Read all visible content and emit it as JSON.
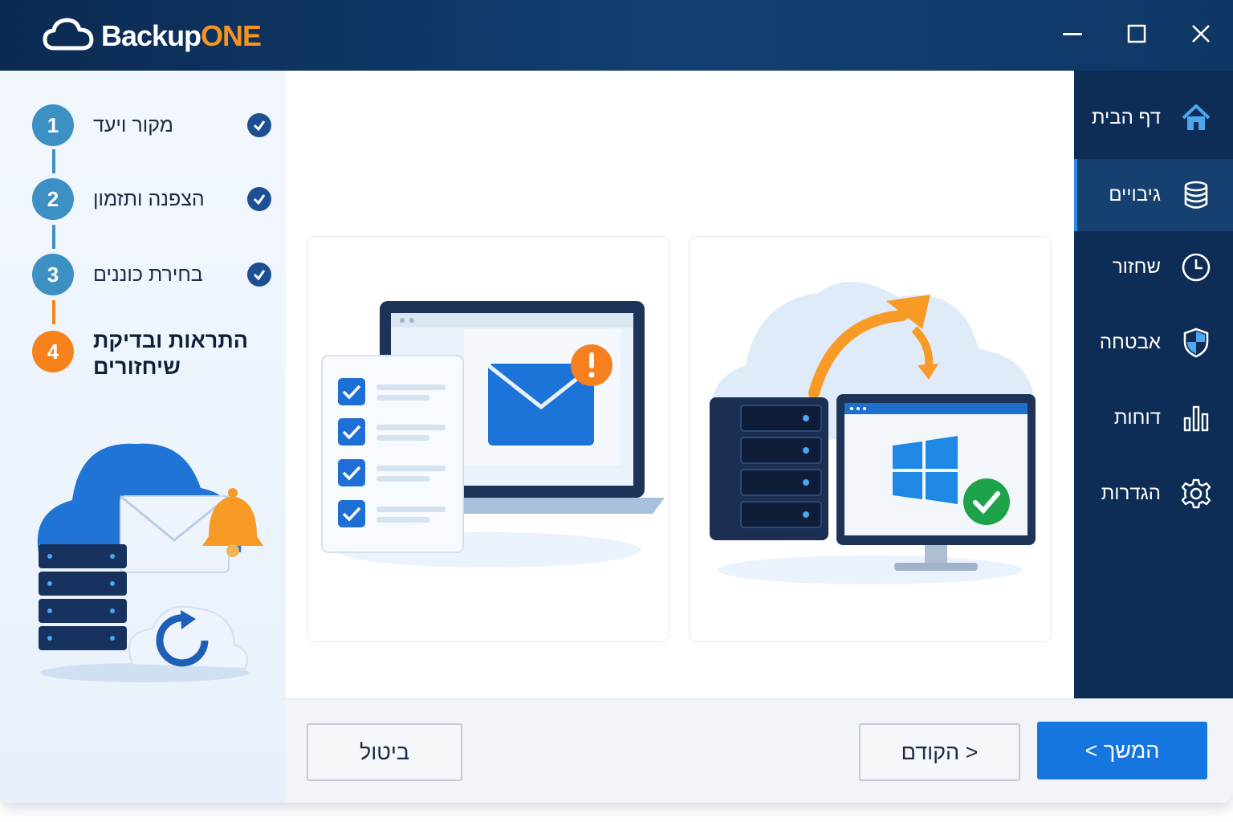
{
  "app": {
    "logo_prefix": "Backup",
    "logo_suffix": "ONE",
    "brand_colors": {
      "titlebar": "#0b2a52",
      "accent_orange": "#f7941d",
      "primary_blue": "#1576e0"
    }
  },
  "window_controls": {
    "minimize_icon": "minimize-icon",
    "maximize_icon": "maximize-icon",
    "close_icon": "close-icon"
  },
  "wizard": {
    "steps": [
      {
        "number": "1",
        "label": "מקור ויעד",
        "state": "completed"
      },
      {
        "number": "2",
        "label": "הצפנה ותזמון",
        "state": "completed"
      },
      {
        "number": "3",
        "label": "בחירת כוננים",
        "state": "completed"
      },
      {
        "number": "4",
        "label_line1": "התראות ובדיקת",
        "label_line2": "שיחזורים",
        "state": "active"
      }
    ]
  },
  "cards": [
    {
      "illustration": "email-alert-checklist-illustration"
    },
    {
      "illustration": "server-restore-windows-illustration"
    }
  ],
  "footer": {
    "cancel_label": "ביטול",
    "prev_label": "< הקודם",
    "next_label": "המשך >"
  },
  "nav": {
    "items": [
      {
        "label": "דף הבית",
        "icon": "home-icon",
        "active": false
      },
      {
        "label": "גיבויים",
        "icon": "database-icon",
        "active": true
      },
      {
        "label": "שחזור",
        "icon": "clock-icon",
        "active": false
      },
      {
        "label": "אבטחה",
        "icon": "shield-icon",
        "active": false
      },
      {
        "label": "דוחות",
        "icon": "bar-chart-icon",
        "active": false
      },
      {
        "label": "הגדרות",
        "icon": "gear-icon",
        "active": false
      }
    ]
  }
}
